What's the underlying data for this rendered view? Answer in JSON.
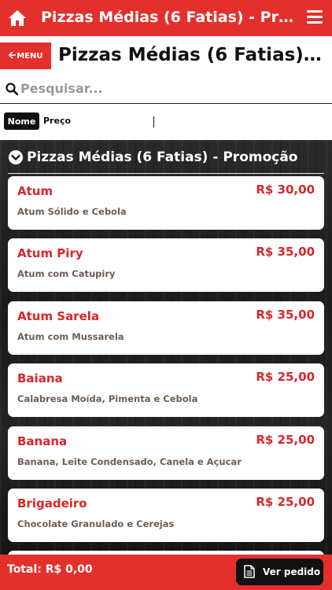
{
  "app": {
    "title": "Pizzas Médias (6 Fatias) - Promoção"
  },
  "header": {
    "title": "Pizzas Médias (6 Fatias) - Promoção",
    "menu_label": "MENU"
  },
  "search": {
    "placeholder": "Pesquisar..."
  },
  "sort": {
    "name_label": "Nome",
    "price_label": "Preço"
  },
  "category": {
    "title": "Pizzas Médias (6 Fatias) - Promoção"
  },
  "items": [
    {
      "name": "Atum",
      "price": "R$ 30,00",
      "desc": "Atum Sólido e Cebola"
    },
    {
      "name": "Atum Piry",
      "price": "R$ 35,00",
      "desc": "Atum com Catupiry"
    },
    {
      "name": "Atum Sarela",
      "price": "R$ 35,00",
      "desc": "Atum com Mussarela"
    },
    {
      "name": "Baiana",
      "price": "R$ 25,00",
      "desc": "Calabresa Moída, Pimenta e Cebola"
    },
    {
      "name": "Banana",
      "price": "R$ 25,00",
      "desc": "Banana, Leite Condensado, Canela e Açucar"
    },
    {
      "name": "Brigadeiro",
      "price": "R$ 25,00",
      "desc": "Chocolate Granulado e Cerejas"
    }
  ],
  "footer": {
    "total": "Total: R$ 0,00",
    "order_button": "Ver pedido"
  },
  "colors": {
    "accent": "#e3302d",
    "item_name": "#d7262a",
    "item_desc": "#6e5e52"
  },
  "icons": {
    "home": "home-icon",
    "menu": "hamburger-icon",
    "search": "search-icon",
    "category": "chevron-down-circle-icon",
    "order": "document-icon"
  }
}
